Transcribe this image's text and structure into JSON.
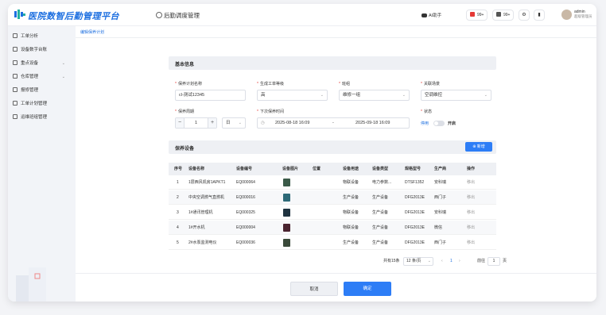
{
  "header": {
    "brand": "医院数智后勤管理平台",
    "page_title": "后勤调度管理",
    "ai_label": "AI助手",
    "badge1": "99+",
    "badge2": "99+",
    "user_name": "admin",
    "user_role": "超级管理员"
  },
  "sidebar": {
    "items": [
      {
        "label": "工单分析",
        "expandable": false
      },
      {
        "label": "设备数字台账",
        "expandable": false
      },
      {
        "label": "重点设备",
        "expandable": true
      },
      {
        "label": "仓库管理",
        "expandable": true
      },
      {
        "label": "报修管理",
        "expandable": false
      },
      {
        "label": "工单计划管理",
        "expandable": false
      },
      {
        "label": "运维班组管理",
        "expandable": false
      }
    ]
  },
  "breadcrumb": "编辑保养计划",
  "basic": {
    "title": "基本信息",
    "plan_name_label": "保养计划名称",
    "plan_name_value": "cl-测试12345",
    "level_label": "生成工单等级",
    "level_value": "高",
    "team_label": "班组",
    "team_value": "维修一组",
    "scene_label": "关联场景",
    "scene_value": "空调维控",
    "period_label": "保养周期",
    "period_value": "1",
    "period_unit": "日",
    "next_label": "下次保养时间",
    "next_start": "2025-08-18 16:09",
    "next_sep": "-",
    "next_end": "2025-09-18 16:09",
    "status_label": "状态",
    "status_off": "停用",
    "status_on": "开启"
  },
  "equipment": {
    "title": "保养设备",
    "add_label": "新增",
    "columns": [
      "序号",
      "设备名称",
      "设备编号",
      "设备图片",
      "位置",
      "设备用途",
      "设备类型",
      "规格型号",
      "生产商",
      "操作"
    ],
    "rows": [
      {
        "no": "1",
        "name": "1层西风机房1APKT1",
        "code": "EQ000064",
        "location": "",
        "usage": "物联设备",
        "type": "电力参数...",
        "model": "DTSF1352",
        "maker": "安科瑞",
        "action": "移出",
        "thumb": "#3a5a48"
      },
      {
        "no": "2",
        "name": "中央空调燃气直燃机",
        "code": "EQ000016",
        "location": "",
        "usage": "生产设备",
        "type": "生产设备",
        "model": "DFG2013E",
        "maker": "西门子",
        "action": "移出",
        "thumb": "#2e6a78"
      },
      {
        "no": "3",
        "name": "1#通讯管理机",
        "code": "EQ000325",
        "location": "",
        "usage": "物联设备",
        "type": "生产设备",
        "model": "DFG2013E",
        "maker": "安科瑞",
        "action": "移出",
        "thumb": "#1f3340"
      },
      {
        "no": "4",
        "name": "1#开水机",
        "code": "EQ000004",
        "location": "",
        "usage": "物联设备",
        "type": "生产设备",
        "model": "DFG2013E",
        "maker": "微信",
        "action": "移出",
        "thumb": "#4a2430"
      },
      {
        "no": "5",
        "name": "2#水泵监测电仪",
        "code": "EQ000036",
        "location": "",
        "usage": "生产设备",
        "type": "生产设备",
        "model": "DFG2013E",
        "maker": "西门子",
        "action": "移出",
        "thumb": "#3a4a3a"
      }
    ]
  },
  "pagination": {
    "total": "共有15条",
    "page_size": "12 条/页",
    "prev": "‹",
    "current": "1",
    "next": "›",
    "goto_label": "前往",
    "goto_value": "1",
    "goto_suffix": "页"
  },
  "footer": {
    "cancel": "取消",
    "confirm": "确定"
  }
}
